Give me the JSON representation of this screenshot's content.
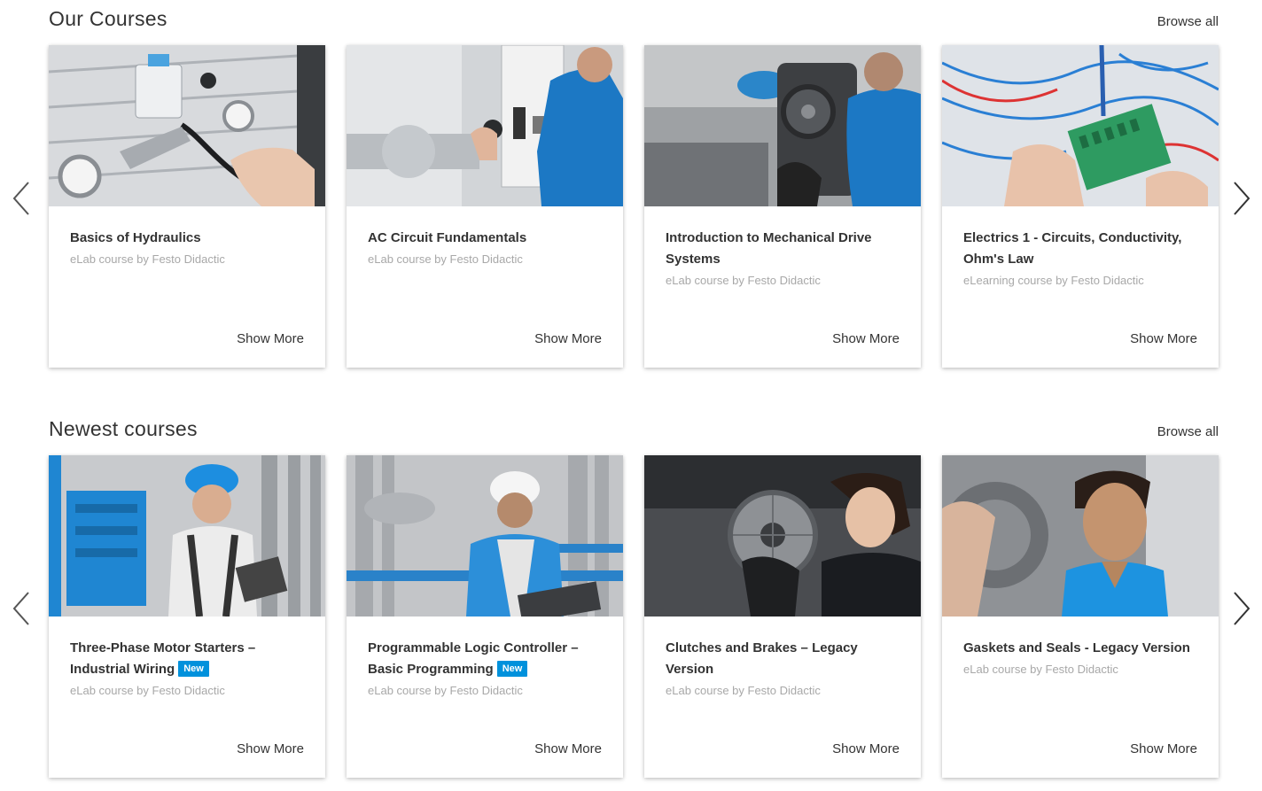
{
  "sections": [
    {
      "title": "Our Courses",
      "browse_all": "Browse all",
      "cards": [
        {
          "title": "Basics of Hydraulics",
          "badge": "",
          "subtitle": "eLab course by Festo Didactic",
          "action": "Show More",
          "image": "hydraulics-photo"
        },
        {
          "title": "AC Circuit Fundamentals",
          "badge": "",
          "subtitle": "eLab course by Festo Didactic",
          "action": "Show More",
          "image": "ac-circuit-photo"
        },
        {
          "title": "Introduction to Mechanical Drive Systems",
          "badge": "",
          "subtitle": "eLab course by Festo Didactic",
          "action": "Show More",
          "image": "mechanical-drive-photo"
        },
        {
          "title": "Electrics 1 - Circuits, Conductivity, Ohm's Law",
          "badge": "",
          "subtitle": "eLearning course by Festo Didactic",
          "action": "Show More",
          "image": "electrics-photo"
        }
      ]
    },
    {
      "title": "Newest courses",
      "browse_all": "Browse all",
      "cards": [
        {
          "title": "Three-Phase Motor Starters – Industrial Wiring",
          "badge": "New",
          "subtitle": "eLab course by Festo Didactic",
          "action": "Show More",
          "image": "motor-starters-photo"
        },
        {
          "title": "Programmable Logic Controller – Basic Programming",
          "badge": "New",
          "subtitle": "eLab course by Festo Didactic",
          "action": "Show More",
          "image": "plc-photo"
        },
        {
          "title": "Clutches and Brakes – Legacy Version",
          "badge": "",
          "subtitle": "eLab course by Festo Didactic",
          "action": "Show More",
          "image": "clutches-photo"
        },
        {
          "title": "Gaskets and Seals - Legacy Version",
          "badge": "",
          "subtitle": "eLab course by Festo Didactic",
          "action": "Show More",
          "image": "gaskets-photo"
        }
      ]
    }
  ],
  "icons": {
    "prev": "chevron-left-icon",
    "next": "chevron-right-icon"
  },
  "colors": {
    "badge": "#0091dc",
    "accent_blue": "#1a8fd6",
    "subtitle_gray": "#a8a8a8"
  }
}
